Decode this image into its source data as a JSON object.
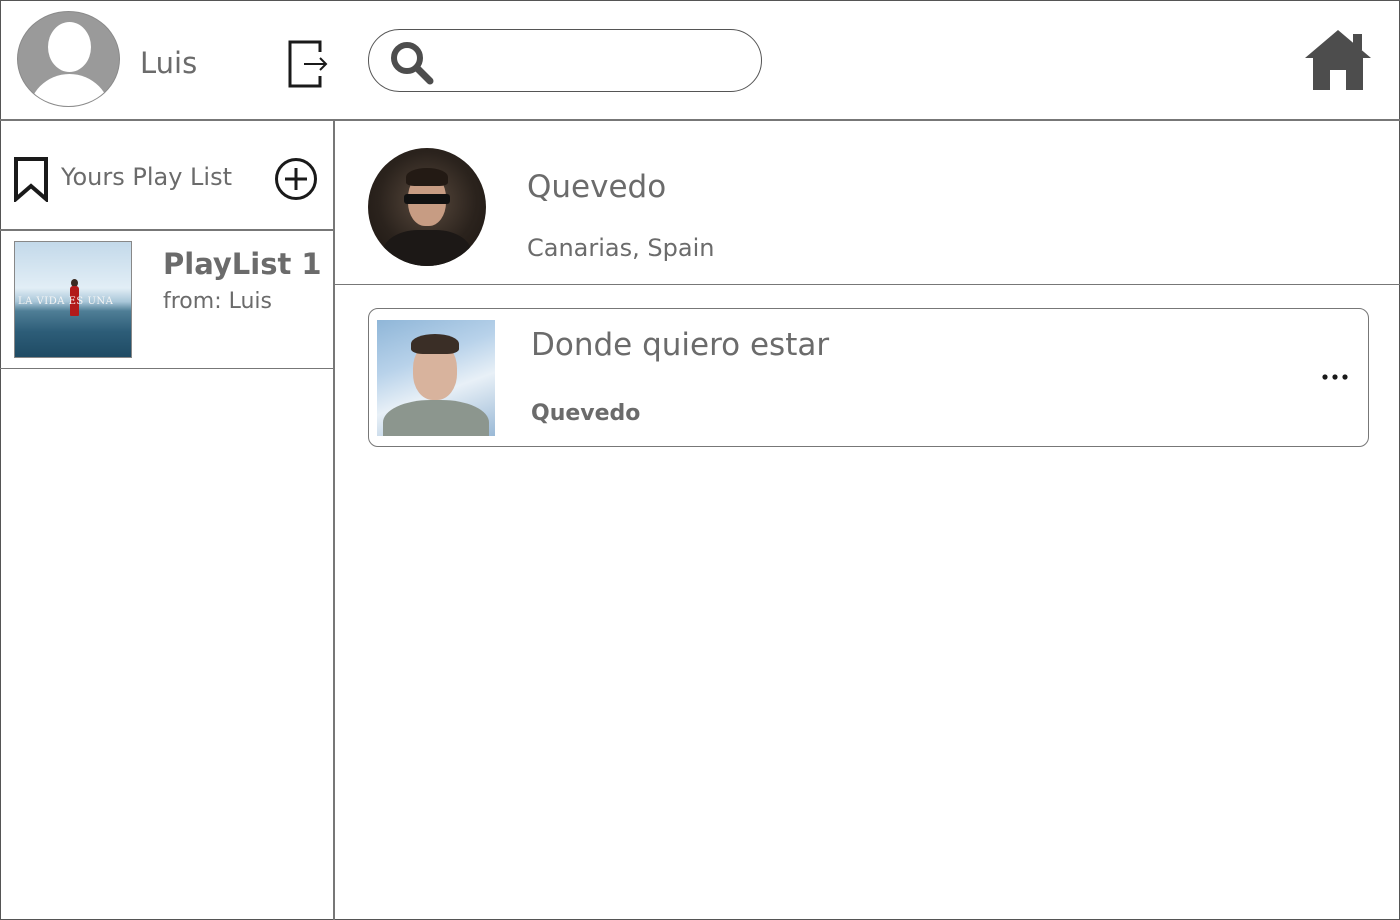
{
  "header": {
    "username": "Luis",
    "search": {
      "value": "",
      "placeholder": ""
    }
  },
  "sidebar": {
    "title": "Yours Play List",
    "playlists": [
      {
        "title": "PlayList 1",
        "subtitle": "from: Luis",
        "cover_text": "LA VIDA ES UNA"
      }
    ]
  },
  "artist": {
    "name": "Quevedo",
    "location": "Canarias, Spain"
  },
  "songs": [
    {
      "title": "Donde quiero estar",
      "artist": "Quevedo"
    }
  ],
  "icons": {
    "logout": "logout-icon",
    "search": "search-icon",
    "home": "home-icon",
    "bookmark": "bookmark-icon",
    "add": "add-circle-icon",
    "more": "more-horizontal-icon"
  },
  "colors": {
    "text": "#6b6b6b",
    "border": "#777777",
    "icon_dark": "#4d4d4d"
  }
}
